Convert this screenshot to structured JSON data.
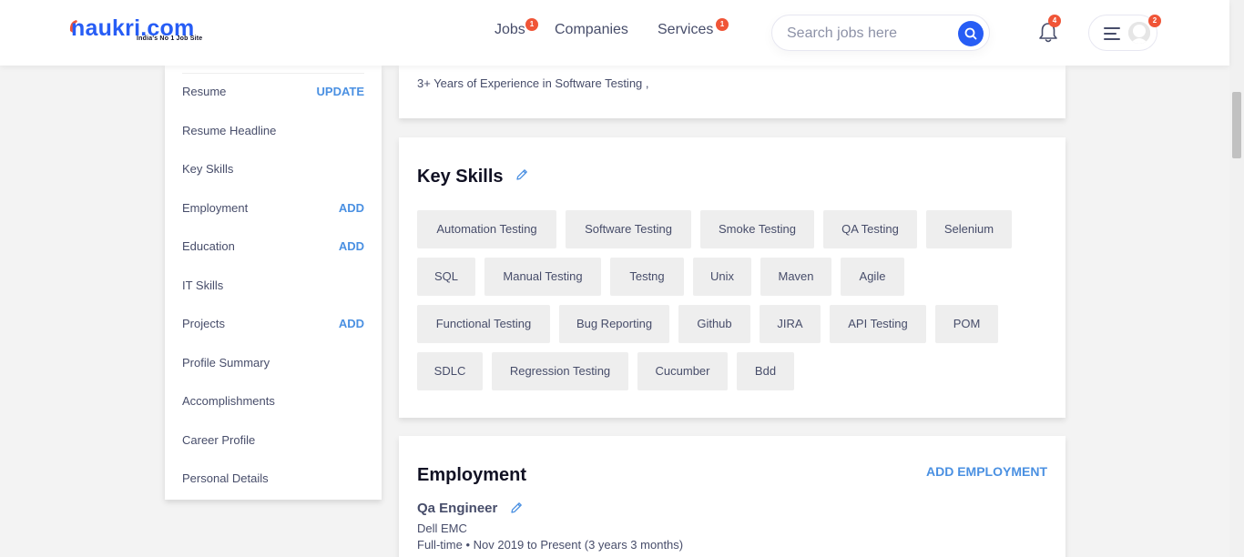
{
  "header": {
    "logo_text": "naukri.com",
    "logo_tagline": "India's No 1 Job Site",
    "nav": [
      {
        "label": "Jobs",
        "badge": "1"
      },
      {
        "label": "Companies"
      },
      {
        "label": "Services",
        "badge": "1"
      }
    ],
    "search_placeholder": "Search jobs here",
    "notifications_count": "4",
    "menu_badge": "2",
    "accent_color": "#275df5",
    "badge_color": "#f05537"
  },
  "sidebar": {
    "items": [
      {
        "label": "Resume",
        "action": "UPDATE"
      },
      {
        "label": "Resume Headline",
        "action": ""
      },
      {
        "label": "Key Skills",
        "action": ""
      },
      {
        "label": "Employment",
        "action": "ADD"
      },
      {
        "label": "Education",
        "action": "ADD"
      },
      {
        "label": "IT Skills",
        "action": ""
      },
      {
        "label": "Projects",
        "action": "ADD"
      },
      {
        "label": "Profile Summary",
        "action": ""
      },
      {
        "label": "Accomplishments",
        "action": ""
      },
      {
        "label": "Career Profile",
        "action": ""
      },
      {
        "label": "Personal Details",
        "action": ""
      }
    ]
  },
  "headline": {
    "text": "3+ Years of Experience in Software Testing ,"
  },
  "key_skills": {
    "title": "Key Skills",
    "skills": [
      "Automation Testing",
      "Software Testing",
      "Smoke Testing",
      "QA Testing",
      "Selenium",
      "SQL",
      "Manual Testing",
      "Testng",
      "Unix",
      "Maven",
      "Agile",
      "Functional Testing",
      "Bug Reporting",
      "Github",
      "JIRA",
      "API Testing",
      "POM",
      "SDLC",
      "Regression Testing",
      "Cucumber",
      "Bdd"
    ]
  },
  "employment": {
    "title": "Employment",
    "add_label": "ADD EMPLOYMENT",
    "role": "Qa Engineer",
    "company": "Dell EMC",
    "period": "Full-time • Nov 2019 to Present (3 years 3 months)"
  }
}
